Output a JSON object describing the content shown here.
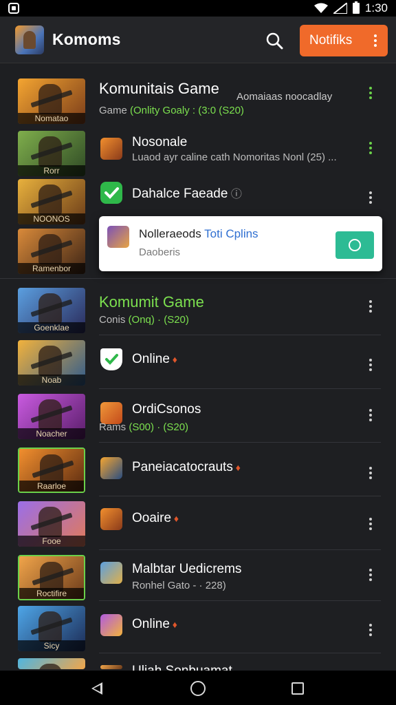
{
  "status_bar": {
    "time": "1:30",
    "left_icon": "app-notification-icon",
    "right_icons": [
      "wifi-icon",
      "signal-icon",
      "battery-icon"
    ]
  },
  "header": {
    "app_title": "Komoms",
    "search_icon": "search-icon",
    "notif_button_label": "Notifiks",
    "accent_color": "#f06a2a"
  },
  "rows": [
    {
      "thumb_caption": "Nomatao",
      "title": "Komunitais Game",
      "title_extra": "Aomaiaas noocadlay",
      "sub_prefix": "Game ",
      "sub_green": "(Onlity Goaly : (3:0  (S20)",
      "thumb_colors": [
        "#f4a531",
        "#7b3d1a"
      ]
    },
    {
      "thumb_caption": "Rorr",
      "title": "Nosonale",
      "sub": "Luaod ayr caline cath Nomoritas Nonl (25) ...",
      "thumb_colors": [
        "#7fae4c",
        "#2f4a25"
      ]
    },
    {
      "thumb_caption": "NOONOS",
      "title": "Dahalce Faeade",
      "thumb_colors": [
        "#e8b13d",
        "#6a3b18"
      ]
    },
    {
      "thumb_caption": "Ramenbor",
      "thumb_colors": [
        "#d98a3a",
        "#3d2415"
      ]
    },
    {
      "thumb_caption": "Goenklae",
      "title": "Komumit Game",
      "sub_prefix": "Conis ",
      "sub_green": "(Onq) · (S20)",
      "thumb_colors": [
        "#5b9fe0",
        "#2a2a5a"
      ]
    },
    {
      "thumb_caption": "Noab",
      "title": "Online",
      "thumb_colors": [
        "#f2b23c",
        "#2f5b8d"
      ]
    },
    {
      "thumb_caption": "Noacher",
      "title": "OrdiCsonos",
      "sub_prefix": "Rams ",
      "sub_green": "(S00) · (S20)",
      "thumb_colors": [
        "#c95be0",
        "#5a1d6a"
      ]
    },
    {
      "thumb_caption": "Raarloe",
      "title": "Paneiacatocrauts",
      "thumb_colors": [
        "#f28f2e",
        "#5a2a10"
      ]
    },
    {
      "thumb_caption": "Fooe",
      "title": "Ooaire",
      "thumb_colors": [
        "#9b6ee8",
        "#e07a5a"
      ]
    },
    {
      "thumb_caption": "Roctifire",
      "title": "Malbtar Uedicrems",
      "sub": "Ronhel Gato - · 228)",
      "thumb_colors": [
        "#f1a54a",
        "#6b3a1a"
      ]
    },
    {
      "thumb_caption": "Sicy",
      "title": "Online",
      "thumb_colors": [
        "#4ea6e8",
        "#1c2b55"
      ]
    },
    {
      "thumb_caption": "",
      "title": "Uliah Sonbuamat",
      "thumb_colors": [
        "#4fb5e0",
        "#f1a64a"
      ]
    }
  ],
  "popup": {
    "title_prefix": "Nolleraeods ",
    "title_blue": "Toti Cplins",
    "sub": "Daoberis"
  },
  "nav": {
    "back_icon": "back-icon",
    "home_icon": "home-icon",
    "recents_icon": "recents-icon"
  }
}
